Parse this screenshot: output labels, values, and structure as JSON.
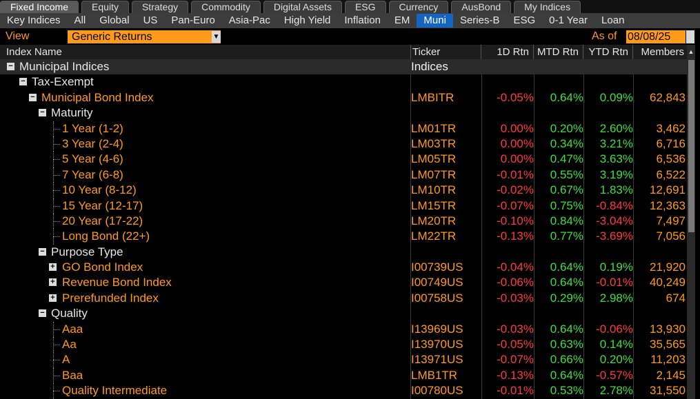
{
  "tabs_primary": [
    "Fixed Income",
    "Equity",
    "Strategy",
    "Commodity",
    "Digital Assets",
    "ESG",
    "Currency",
    "AusBond",
    "My Indices"
  ],
  "tabs_secondary": [
    "Key Indices",
    "All",
    "Global",
    "US",
    "Pan-Euro",
    "Asia-Pac",
    "High Yield",
    "Inflation",
    "EM",
    "Muni",
    "Series-B",
    "ESG",
    "0-1 Year",
    "Loan"
  ],
  "view": {
    "label": "View",
    "value": "Generic Returns",
    "asof_label": "As of",
    "asof_value": "08/08/25"
  },
  "columns": {
    "name": "Index Name",
    "ticker": "Ticker",
    "d1": "1D Rtn",
    "mtd": "MTD Rtn",
    "ytd": "YTD Rtn",
    "members": "Members"
  },
  "rows": [
    {
      "name": "Municipal Indices",
      "ticker": "Indices",
      "level": 0,
      "toggle": "minus",
      "type": "group"
    },
    {
      "name": "Tax-Exempt",
      "level": 1,
      "toggle": "minus",
      "type": "node"
    },
    {
      "name": "Municipal Bond Index",
      "ticker": "LMBITR",
      "d1": "-0.05%",
      "mtd": "0.64%",
      "ytd": "0.09%",
      "members": "62,843",
      "level": 2,
      "toggle": "minus",
      "type": "index"
    },
    {
      "name": "Maturity",
      "level": 3,
      "toggle": "minus",
      "type": "node"
    },
    {
      "name": "1 Year (1-2)",
      "ticker": "LM01TR",
      "d1": "0.00%",
      "mtd": "0.20%",
      "ytd": "2.60%",
      "members": "3,462",
      "level": 4,
      "type": "leaf"
    },
    {
      "name": "3 Year (2-4)",
      "ticker": "LM03TR",
      "d1": "0.00%",
      "mtd": "0.34%",
      "ytd": "3.21%",
      "members": "6,716",
      "level": 4,
      "type": "leaf"
    },
    {
      "name": "5 Year (4-6)",
      "ticker": "LM05TR",
      "d1": "0.00%",
      "mtd": "0.47%",
      "ytd": "3.63%",
      "members": "6,536",
      "level": 4,
      "type": "leaf"
    },
    {
      "name": "7 Year (6-8)",
      "ticker": "LM07TR",
      "d1": "-0.01%",
      "mtd": "0.55%",
      "ytd": "3.19%",
      "members": "6,522",
      "level": 4,
      "type": "leaf"
    },
    {
      "name": "10 Year (8-12)",
      "ticker": "LM10TR",
      "d1": "-0.02%",
      "mtd": "0.67%",
      "ytd": "1.83%",
      "members": "12,691",
      "level": 4,
      "type": "leaf"
    },
    {
      "name": "15 Year (12-17)",
      "ticker": "LM15TR",
      "d1": "-0.07%",
      "mtd": "0.75%",
      "ytd": "-0.84%",
      "members": "12,363",
      "level": 4,
      "type": "leaf"
    },
    {
      "name": "20 Year (17-22)",
      "ticker": "LM20TR",
      "d1": "-0.10%",
      "mtd": "0.84%",
      "ytd": "-3.04%",
      "members": "7,497",
      "level": 4,
      "type": "leaf"
    },
    {
      "name": "Long Bond (22+)",
      "ticker": "LM22TR",
      "d1": "-0.13%",
      "mtd": "0.77%",
      "ytd": "-3.69%",
      "members": "7,056",
      "level": 4,
      "type": "leaf"
    },
    {
      "name": "Purpose Type",
      "level": 3,
      "toggle": "minus",
      "type": "node"
    },
    {
      "name": "GO Bond Index",
      "ticker": "I00739US",
      "d1": "-0.04%",
      "mtd": "0.64%",
      "ytd": "0.19%",
      "members": "21,920",
      "level": 4,
      "toggle": "plus",
      "type": "leaf"
    },
    {
      "name": "Revenue Bond Index",
      "ticker": "I00749US",
      "d1": "-0.06%",
      "mtd": "0.64%",
      "ytd": "-0.01%",
      "members": "40,249",
      "level": 4,
      "toggle": "plus",
      "type": "leaf"
    },
    {
      "name": "Prerefunded Index",
      "ticker": "I00758US",
      "d1": "-0.03%",
      "mtd": "0.29%",
      "ytd": "2.98%",
      "members": "674",
      "level": 4,
      "toggle": "plus",
      "type": "leaf"
    },
    {
      "name": "Quality",
      "level": 3,
      "toggle": "minus",
      "type": "node"
    },
    {
      "name": "Aaa",
      "ticker": "I13969US",
      "d1": "-0.03%",
      "mtd": "0.64%",
      "ytd": "-0.06%",
      "members": "13,930",
      "level": 4,
      "type": "leaf"
    },
    {
      "name": "Aa",
      "ticker": "I13970US",
      "d1": "-0.05%",
      "mtd": "0.63%",
      "ytd": "0.14%",
      "members": "35,565",
      "level": 4,
      "type": "leaf"
    },
    {
      "name": "A",
      "ticker": "I13971US",
      "d1": "-0.07%",
      "mtd": "0.66%",
      "ytd": "0.20%",
      "members": "11,203",
      "level": 4,
      "type": "leaf"
    },
    {
      "name": "Baa",
      "ticker": "LMB1TR",
      "d1": "-0.13%",
      "mtd": "0.64%",
      "ytd": "-0.57%",
      "members": "2,145",
      "level": 4,
      "type": "leaf"
    },
    {
      "name": "Quality Intermediate",
      "ticker": "I00780US",
      "d1": "-0.01%",
      "mtd": "0.53%",
      "ytd": "2.78%",
      "members": "31,550",
      "level": 4,
      "type": "leaf"
    }
  ],
  "colors": {
    "orange": "#ff9a1a",
    "positive": "#3ee03e",
    "negative": "#ff3b3b",
    "zero": "#ff3b3b",
    "active_tab": "#1565c0"
  }
}
